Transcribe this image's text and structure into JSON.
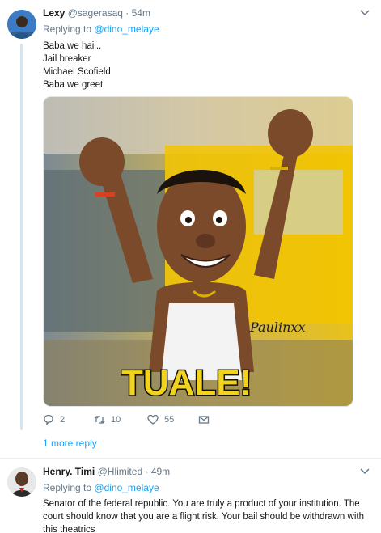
{
  "tweets": [
    {
      "name": "Lexy",
      "handle": "@sagerasaq",
      "separator": "·",
      "time": "54m",
      "replying_label": "Replying to",
      "replying_to": "@dino_melaye",
      "lines": [
        "Baba we hail..",
        "Jail breaker",
        "Michael Scofield",
        "Baba we greet"
      ],
      "media_text": "TUALE!",
      "media_signature": "Paulinxx",
      "actions": {
        "replies": "2",
        "retweets": "10",
        "likes": "55"
      },
      "more_replies": "1 more reply"
    },
    {
      "name": "Henry. Timi",
      "handle": "@Hlimited",
      "separator": "·",
      "time": "49m",
      "replying_label": "Replying to",
      "replying_to": "@dino_melaye",
      "text": "Senator of the federal republic. You are truly a product of your institution. The court should know that you are a flight risk. Your bail should be withdrawn with this theatrics"
    }
  ],
  "icons": [
    "chevron-down-icon",
    "reply-icon",
    "retweet-icon",
    "like-icon",
    "message-icon"
  ],
  "colors": {
    "link": "#1da1f2",
    "muted": "#657786",
    "thread": "#cfe6f7",
    "media_yellow": "#f2c400"
  }
}
